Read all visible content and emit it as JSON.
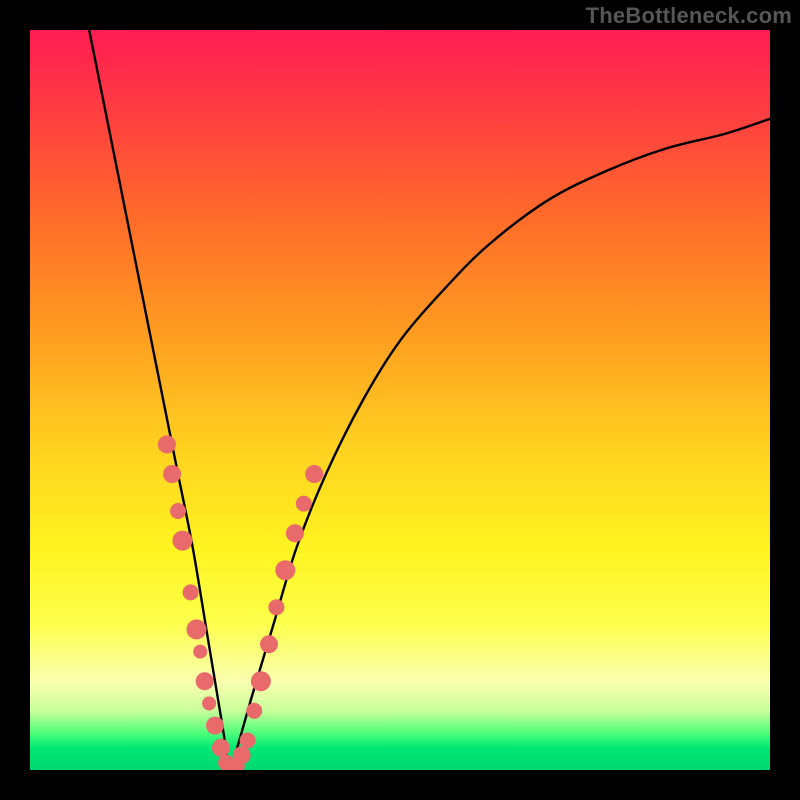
{
  "watermark": "TheBottleneck.com",
  "colors": {
    "dot": "#e86a6a",
    "curve": "#000000",
    "frame": "#000000"
  },
  "chart_data": {
    "type": "line",
    "title": "",
    "xlabel": "",
    "ylabel": "",
    "xlim": [
      0,
      100
    ],
    "ylim": [
      0,
      100
    ],
    "note": "Axes are unlabeled in the image; x/y run 0–100 left→right and bottom→top. Curve is a V-shaped bottleneck curve with minimum near x≈27, y≈0. The curve touches the top edge on the left at x≈8 and re-enters the top band on the right near x≈100, y≈88. Pink dots cluster along both arms near the trough.",
    "curve_points": {
      "x": [
        8,
        10,
        12,
        14,
        16,
        18,
        20,
        22,
        24,
        26,
        27,
        28,
        30,
        33,
        36,
        40,
        45,
        50,
        56,
        62,
        70,
        78,
        86,
        94,
        100
      ],
      "y": [
        100,
        90,
        80,
        70,
        60,
        50,
        40,
        30,
        18,
        6,
        0,
        3,
        10,
        20,
        30,
        40,
        50,
        58,
        65,
        71,
        77,
        81,
        84,
        86,
        88
      ]
    },
    "series": [
      {
        "name": "left-arm-dots",
        "x": [
          18.5,
          19.2,
          20.0,
          20.6,
          21.7,
          22.5,
          23.0,
          23.6,
          24.2,
          25.0,
          25.8,
          26.5
        ],
        "y": [
          44,
          40,
          35,
          31,
          24,
          19,
          16,
          12,
          9,
          6,
          3,
          1
        ],
        "r": [
          9,
          9,
          8,
          10,
          8,
          10,
          7,
          9,
          7,
          9,
          9,
          8
        ]
      },
      {
        "name": "trough-dots",
        "x": [
          27.0,
          27.8,
          28.6,
          29.4
        ],
        "y": [
          0,
          0.5,
          2,
          4
        ],
        "r": [
          9,
          9,
          9,
          8
        ]
      },
      {
        "name": "right-arm-dots",
        "x": [
          30.3,
          31.2,
          32.3,
          33.3,
          34.5,
          35.8,
          37.0,
          38.4
        ],
        "y": [
          8,
          12,
          17,
          22,
          27,
          32,
          36,
          40
        ],
        "r": [
          8,
          10,
          9,
          8,
          10,
          9,
          8,
          9
        ]
      }
    ]
  }
}
